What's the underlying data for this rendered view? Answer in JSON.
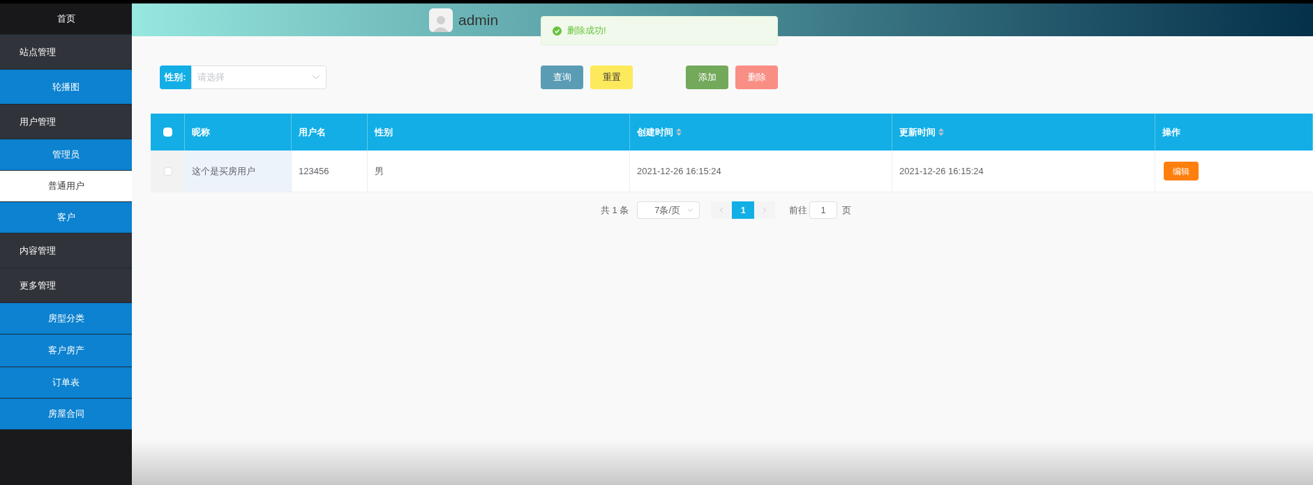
{
  "sidebar": {
    "items": [
      {
        "label": "首页",
        "kind": "home",
        "selected": false
      },
      {
        "label": "站点管理",
        "kind": "group",
        "selected": false
      },
      {
        "label": "轮播图",
        "kind": "sub",
        "selected": false
      },
      {
        "label": "用户管理",
        "kind": "group",
        "selected": false
      },
      {
        "label": "管理员",
        "kind": "sub",
        "selected": false
      },
      {
        "label": "普通用户",
        "kind": "sub",
        "selected": true
      },
      {
        "label": "客户",
        "kind": "sub",
        "selected": false
      },
      {
        "label": "内容管理",
        "kind": "group",
        "selected": false
      },
      {
        "label": "更多管理",
        "kind": "group",
        "selected": false
      },
      {
        "label": "房型分类",
        "kind": "sub",
        "selected": false
      },
      {
        "label": "客户房产",
        "kind": "sub",
        "selected": false
      },
      {
        "label": "订单表",
        "kind": "sub",
        "selected": false
      },
      {
        "label": "房屋合同",
        "kind": "sub",
        "selected": false
      }
    ]
  },
  "header": {
    "username": "admin"
  },
  "toast": {
    "message": "删除成功!"
  },
  "filter": {
    "label": "性别:",
    "placeholder": "请选择"
  },
  "buttons": [
    {
      "label": "查询",
      "color": "#5b9cb5"
    },
    {
      "label": "重置",
      "color": "#fde95c"
    },
    {
      "label": "添加",
      "color": "#73a95a"
    },
    {
      "label": "删除",
      "color": "#f98e85"
    }
  ],
  "table": {
    "all_checked": false,
    "columns": [
      {
        "label": "昵称",
        "sortable": false
      },
      {
        "label": "用户名",
        "sortable": false
      },
      {
        "label": "性别",
        "sortable": false
      },
      {
        "label": "创建时间",
        "sortable": true
      },
      {
        "label": "更新时间",
        "sortable": true
      },
      {
        "label": "操作",
        "sortable": false
      }
    ],
    "rows": [
      {
        "checked": false,
        "cells": [
          "这个是买房用户",
          "123456",
          "男",
          "2021-12-26 16:15:24",
          "2021-12-26 16:15:24"
        ],
        "action": "编辑"
      }
    ]
  },
  "pagination": {
    "total": "共 1 条",
    "page_size": "7条/页",
    "pages": [
      {
        "label": "1",
        "selected": true
      }
    ],
    "goto_label": "前往",
    "goto_value": "1",
    "goto_suffix": "页"
  }
}
